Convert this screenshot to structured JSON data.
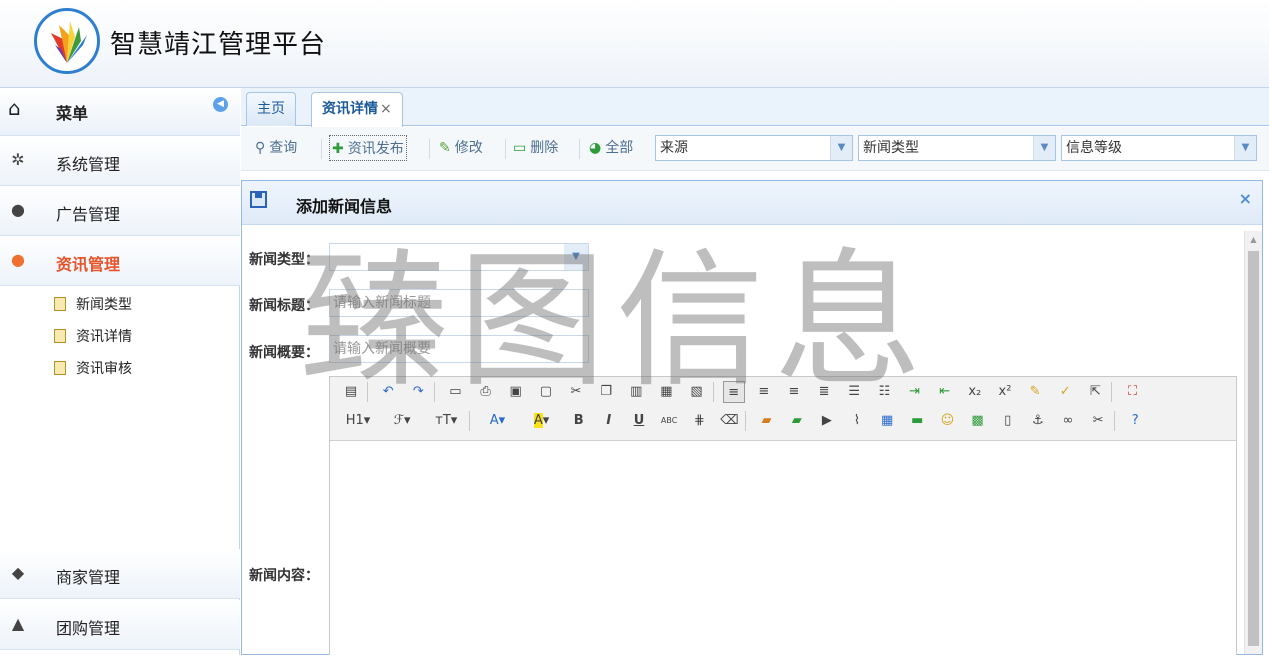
{
  "app": {
    "title": "智慧靖江管理平台"
  },
  "sidebar": {
    "menu_label": "菜单",
    "items": [
      {
        "label": "系统管理",
        "icon": "gear-icon"
      },
      {
        "label": "广告管理",
        "icon": "lightbulb-icon"
      },
      {
        "label": "资讯管理",
        "icon": "chat-bubble-icon",
        "active": true
      },
      {
        "label": "商家管理",
        "icon": "tag-icon"
      },
      {
        "label": "团购管理",
        "icon": "pin-icon"
      }
    ],
    "sub_items": [
      {
        "label": "新闻类型"
      },
      {
        "label": "资讯详情"
      },
      {
        "label": "资讯审核"
      }
    ]
  },
  "tabs": [
    {
      "label": "主页"
    },
    {
      "label": "资讯详情",
      "close": "×",
      "active": true
    }
  ],
  "toolbar": {
    "query": "查询",
    "publish": "资讯发布",
    "edit": "修改",
    "delete": "删除",
    "all": "全部",
    "filters": [
      {
        "value": "来源"
      },
      {
        "value": "新闻类型"
      },
      {
        "value": "信息等级"
      }
    ]
  },
  "dialog": {
    "title": "添加新闻信息",
    "close": "×",
    "fields": {
      "type_label": "新闻类型：",
      "type_value": "",
      "title_label": "新闻标题：",
      "title_placeholder": "请输入新闻标题",
      "summary_label": "新闻概要：",
      "summary_placeholder": "请输入新闻概要",
      "content_label": "新闻内容："
    },
    "editor": {
      "heading_btn": "H1",
      "bold": "B",
      "italic": "I",
      "underline": "U",
      "strike": "ABC"
    }
  },
  "watermark": "臻图信息",
  "colors": {
    "accent": "#1c5a9a",
    "active_menu": "#e8542a",
    "border": "#a7c4e2"
  }
}
